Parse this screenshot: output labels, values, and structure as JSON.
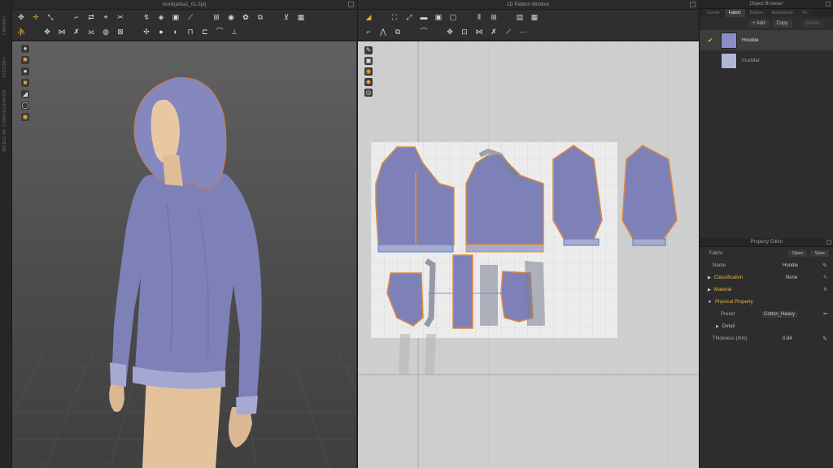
{
  "colors": {
    "fabric_hoodie": "#8b8dc6",
    "fabric_muddar": "#b2b6d6",
    "accent_orange": "#e08a3a",
    "skin": "#e6c7a3"
  },
  "sidebar": {
    "label_top": "LIBRARY",
    "label_mid": "HISTORY",
    "label_bot": "MODULAR CONFIGURATOR"
  },
  "window3d": {
    "title": "monkjacka1_01.Zprj"
  },
  "window2d": {
    "title": "2D Pattern Window"
  },
  "object_browser": {
    "title": "Object Browser",
    "tabs": [
      "Scene",
      "Fabric",
      "Button",
      "Buttonhole",
      "To"
    ],
    "active_tab": 1,
    "add_label": "+ Add",
    "copy_label": "Copy",
    "delete_label": "Delete",
    "fabrics": [
      {
        "name": "Hoodie",
        "selected": true
      },
      {
        "name": "muddar",
        "selected": false
      }
    ]
  },
  "property_editor": {
    "title": "Property Editor",
    "header_label": "Fabric",
    "open_label": "Open",
    "save_label": "Save",
    "name_key": "Name",
    "name_value": "Hoodie",
    "classification_key": "Classification",
    "classification_value": "None",
    "material_label": "Material",
    "physical_label": "Physical Property",
    "preset_key": "Preset",
    "preset_value": "Cotton_Heavy",
    "detail_label": "Detail",
    "thickness_key": "Thickness (mm)",
    "thickness_value": "0.84"
  },
  "icons": {
    "toolbar3d_row1": [
      "move-icon",
      "transform-icon",
      "select-icon",
      "fold-icon",
      "pin-icon",
      "simulate-icon",
      "tack-icon",
      "grid-icon"
    ],
    "toolbar2d_row1": [
      "transform-pattern-icon",
      "edit-pattern-icon",
      "rectangle-icon",
      "polygon-icon",
      "sewing-icon",
      "grid-icon"
    ]
  }
}
